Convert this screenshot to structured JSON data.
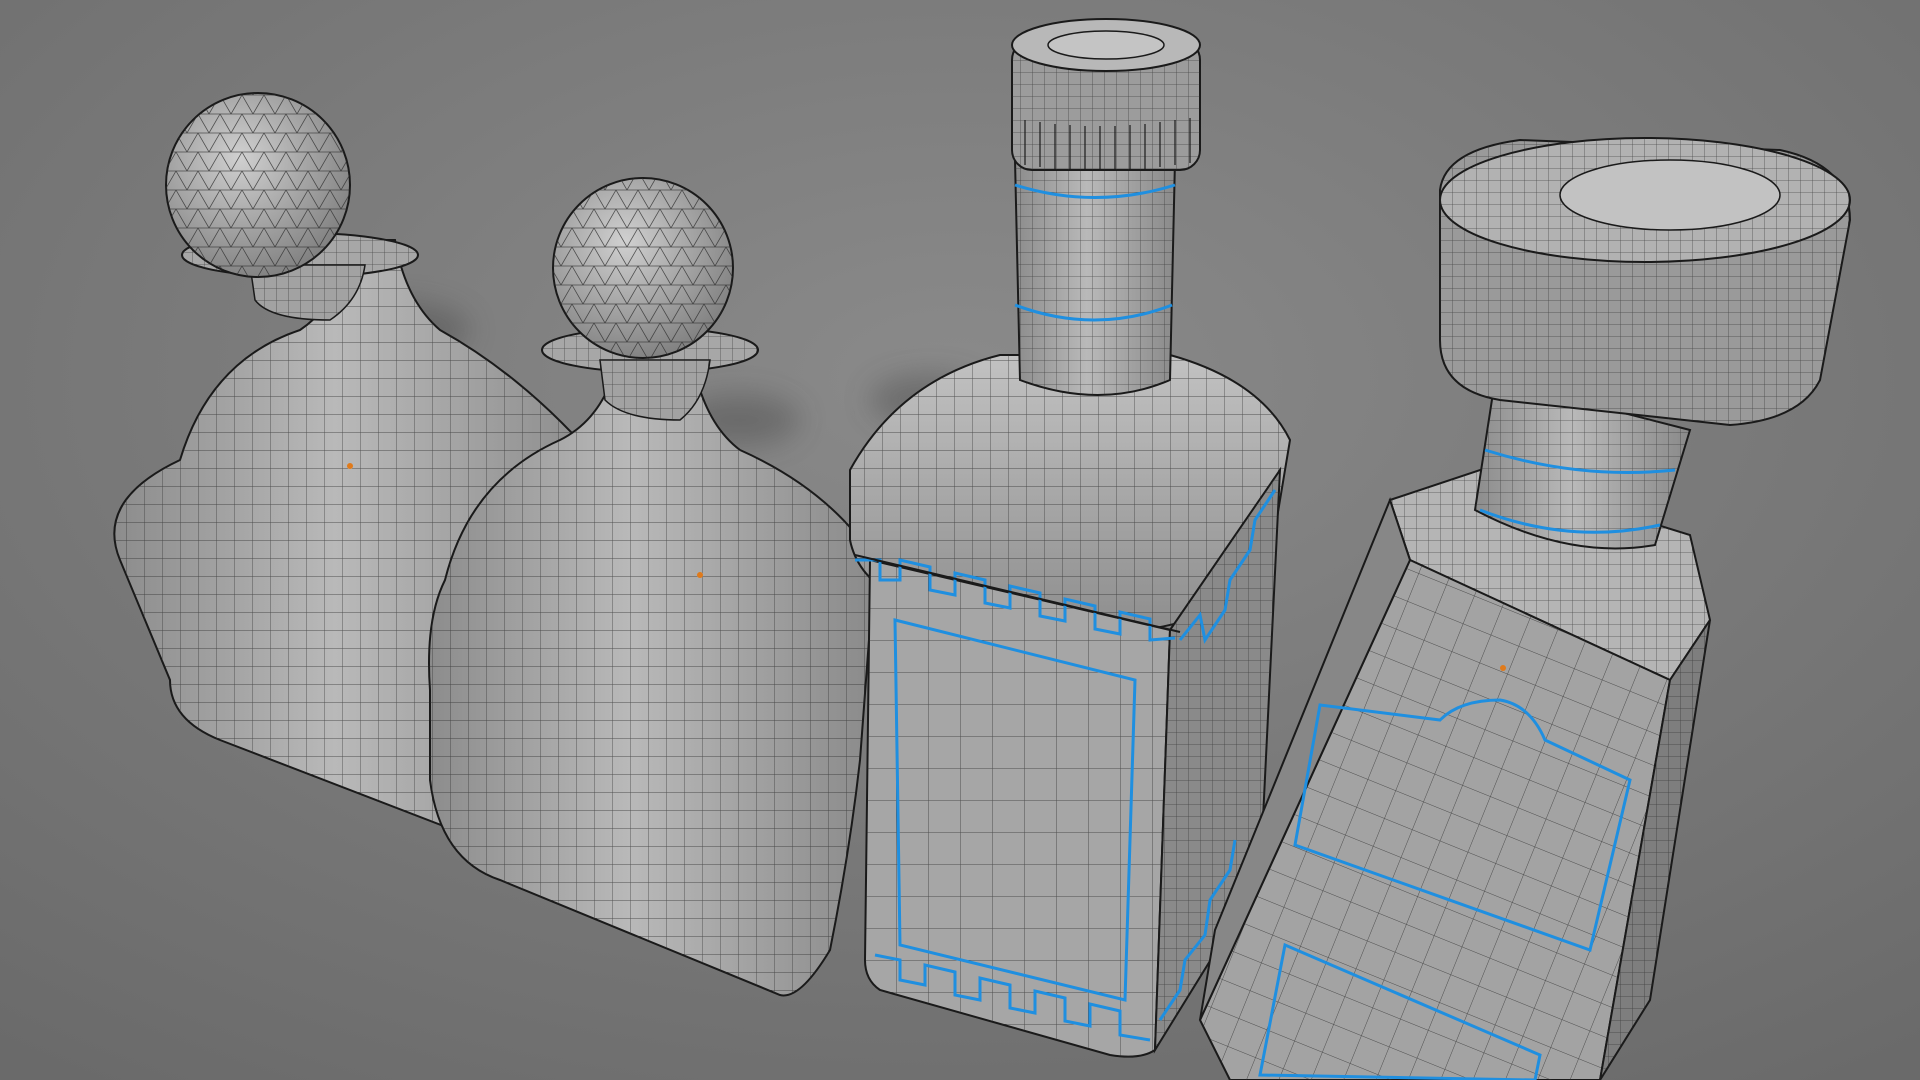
{
  "scene": {
    "description_visible_text": "",
    "objects": [
      {
        "name": "decanter-left",
        "kind": "bottle-with-ball-stopper"
      },
      {
        "name": "decanter-middle",
        "kind": "bottle-with-ball-stopper"
      },
      {
        "name": "square-bottle",
        "kind": "bottle-with-screw-cap"
      },
      {
        "name": "tilted-bottle",
        "kind": "bottle-with-large-cap"
      }
    ],
    "colors": {
      "background": "#7d7d7d",
      "mesh_fill": "#a9a9a9",
      "mesh_shadow": "#6f6f6f",
      "wire": "#2a2a2a",
      "seam": "#1f8fe0",
      "vertex_dot": "#e07a1a"
    }
  }
}
